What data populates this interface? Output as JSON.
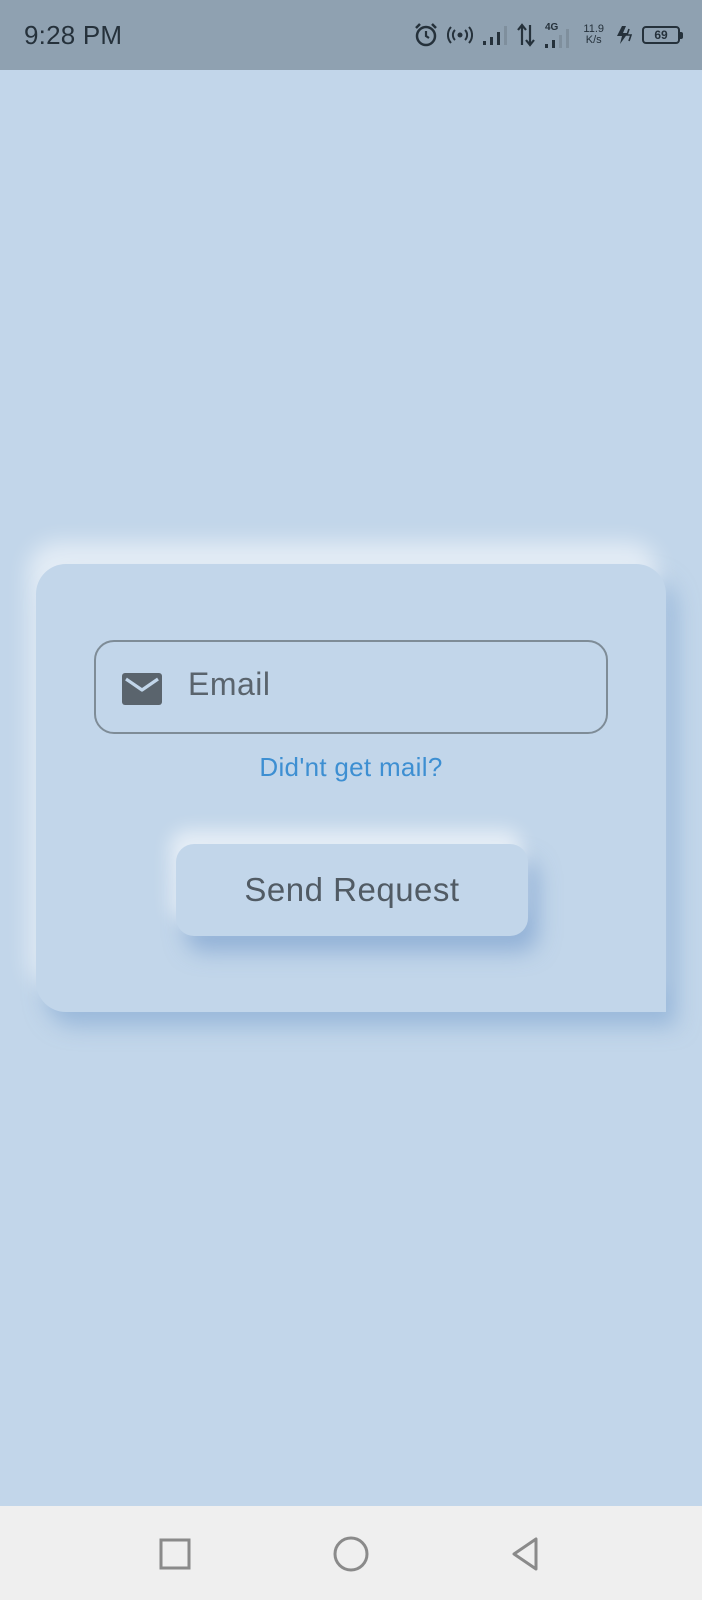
{
  "status_bar": {
    "time": "9:28 PM",
    "network_type": "4G",
    "speed_value": "11.9",
    "speed_unit": "K/s",
    "battery_level": "69"
  },
  "form": {
    "email_placeholder": "Email",
    "resend_link_label": "Did'nt get mail?",
    "send_button_label": "Send Request"
  },
  "nav": {
    "recents_icon": "square-icon",
    "home_icon": "circle-icon",
    "back_icon": "triangle-back-icon"
  },
  "colors": {
    "background": "#c2d6ea",
    "link": "#3d8fd2",
    "text": "#5a646d",
    "status_bar": "#8fa1b1"
  }
}
